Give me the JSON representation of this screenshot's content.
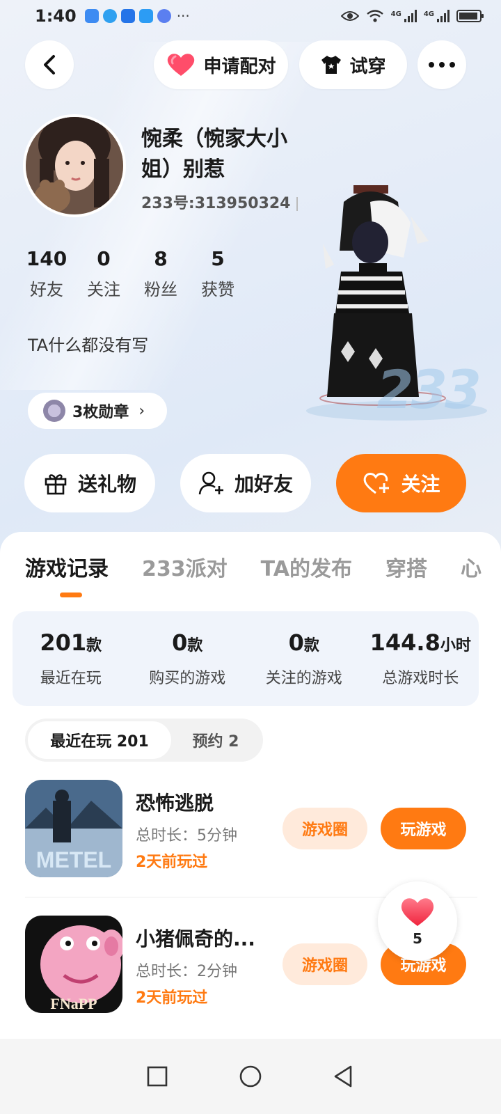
{
  "status_bar": {
    "time": "1:40",
    "more": "···",
    "signal_1": "4G",
    "signal_2": "4G"
  },
  "top_bar": {
    "pair_label": "申请配对",
    "try_label": "试穿"
  },
  "profile": {
    "nickname": "惋柔（惋家大小姐）别惹",
    "uid": "233号:313950324",
    "stats": [
      {
        "value": "140",
        "label": "好友"
      },
      {
        "value": "0",
        "label": "关注"
      },
      {
        "value": "8",
        "label": "粉丝"
      },
      {
        "value": "5",
        "label": "获赞"
      }
    ],
    "bio": "TA什么都没有写",
    "medal_label": "3枚勋章",
    "deco_text": "233"
  },
  "actions": {
    "gift_label": "送礼物",
    "add_friend_label": "加好友",
    "follow_label": "关注"
  },
  "tabs": [
    "游戏记录",
    "233派对",
    "TA的发布",
    "穿搭",
    "心"
  ],
  "summary": [
    {
      "num": "201",
      "unit": "款",
      "label": "最近在玩"
    },
    {
      "num": "0",
      "unit": "款",
      "label": "购买的游戏"
    },
    {
      "num": "0",
      "unit": "款",
      "label": "关注的游戏"
    },
    {
      "num": "144.8",
      "unit": "小时",
      "label": "总游戏时长"
    }
  ],
  "segments": {
    "recent": "最近在玩 201",
    "reserve": "预约 2"
  },
  "games": [
    {
      "title": "恐怖逃脱",
      "duration": "总时长：5分钟",
      "last_played": "2天前玩过",
      "icon_text": "METEL",
      "circle_label": "游戏圈",
      "play_label": "玩游戏"
    },
    {
      "title": "小猪佩奇的...",
      "duration": "总时长：2分钟",
      "last_played": "2天前玩过",
      "icon_text": "FNaPP",
      "circle_label": "游戏圈",
      "play_label": "玩游戏"
    }
  ],
  "like_float": {
    "count": "5"
  },
  "colors": {
    "accent": "#ff7a12",
    "accent_light": "#ffeadb",
    "heart": "#ff4d6a"
  }
}
